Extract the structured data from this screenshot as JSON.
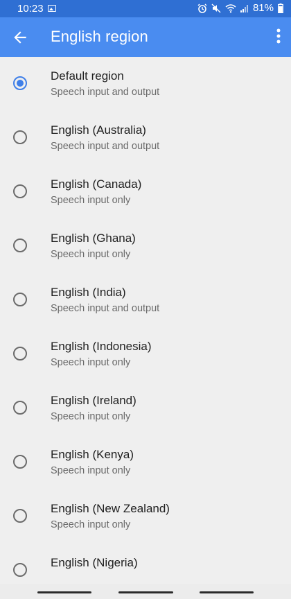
{
  "status_bar": {
    "time": "10:23",
    "battery": "81%",
    "icons": [
      "gallery-icon",
      "alarm-icon",
      "mute-icon",
      "wifi-icon",
      "signal-icon",
      "battery-icon"
    ]
  },
  "app_bar": {
    "title": "English region",
    "back_icon": "arrow-back-icon",
    "menu_icon": "more-vert-icon"
  },
  "regions": [
    {
      "label": "Default region",
      "subtitle": "Speech input and output",
      "selected": true
    },
    {
      "label": "English (Australia)",
      "subtitle": "Speech input and output",
      "selected": false
    },
    {
      "label": "English (Canada)",
      "subtitle": "Speech input only",
      "selected": false
    },
    {
      "label": "English (Ghana)",
      "subtitle": "Speech input only",
      "selected": false
    },
    {
      "label": "English (India)",
      "subtitle": "Speech input and output",
      "selected": false
    },
    {
      "label": "English (Indonesia)",
      "subtitle": "Speech input only",
      "selected": false
    },
    {
      "label": "English (Ireland)",
      "subtitle": "Speech input only",
      "selected": false
    },
    {
      "label": "English (Kenya)",
      "subtitle": "Speech input only",
      "selected": false
    },
    {
      "label": "English (New Zealand)",
      "subtitle": "Speech input only",
      "selected": false
    },
    {
      "label": "English (Nigeria)",
      "subtitle": "",
      "selected": false
    }
  ],
  "colors": {
    "status_bar": "#2f6fd3",
    "app_bar": "#4a8cf0",
    "accent": "#3f7fe8",
    "background": "#efefef"
  }
}
